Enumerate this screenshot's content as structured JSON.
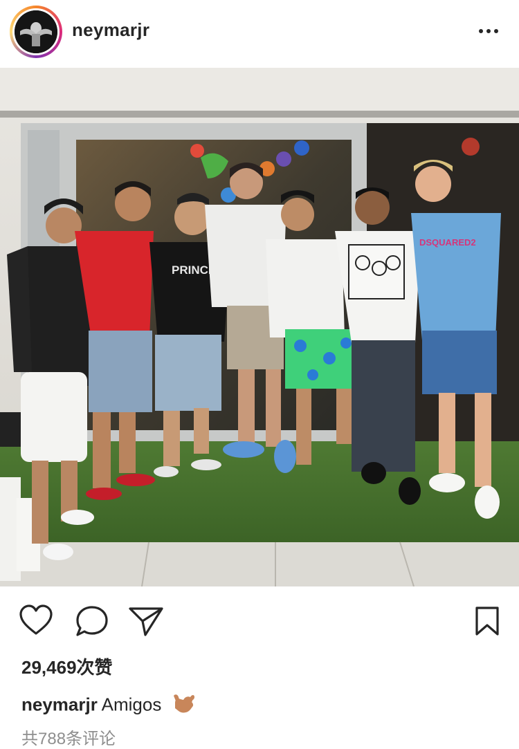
{
  "post": {
    "username": "neymarjr",
    "more_icon": "more-horizontal-icon",
    "likes_text": "29,469次赞",
    "caption": {
      "username": "neymarjr",
      "text": "Amigos",
      "emoji": "call-me-hand-emoji"
    },
    "comments_link": "共788条评论",
    "actions": [
      "heart-icon",
      "comment-icon",
      "share-icon",
      "bookmark-icon"
    ]
  },
  "photo": {
    "shirt_texts": [
      "PRINCE",
      "DSQUARED2"
    ]
  },
  "colors": {
    "text": "#262626",
    "muted": "#8e8e8e",
    "avatar_ring_start": "#f58529",
    "avatar_ring_end": "#dd2a7b"
  }
}
